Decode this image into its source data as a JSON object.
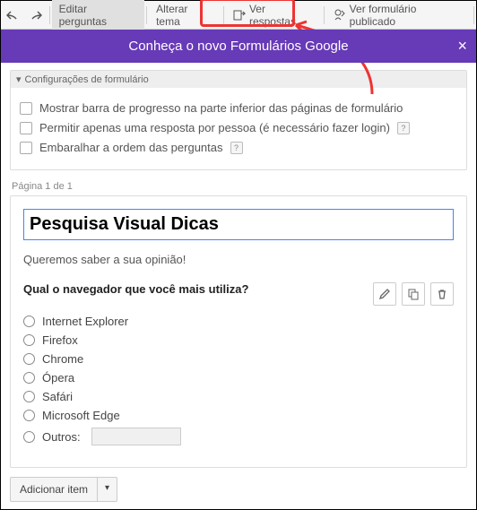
{
  "toolbar": {
    "edit_questions": "Editar perguntas",
    "change_theme": "Alterar tema",
    "view_responses": "Ver respostas",
    "view_published": "Ver formulário publicado"
  },
  "banner": {
    "text": "Conheça o novo Formulários Google"
  },
  "settings": {
    "header": "Configurações de formulário",
    "progress_bar": "Mostrar barra de progresso na parte inferior das páginas de formulário",
    "one_response": "Permitir apenas uma resposta por pessoa (é necessário fazer login)",
    "shuffle": "Embaralhar a ordem das perguntas"
  },
  "page_label": "Página 1 de 1",
  "form": {
    "title": "Pesquisa Visual Dicas",
    "description": "Queremos saber a sua opinião!",
    "question": "Qual o navegador que você mais utiliza?",
    "options": [
      "Internet Explorer",
      "Firefox",
      "Chrome",
      "Ópera",
      "Safári",
      "Microsoft Edge"
    ],
    "other_label": "Outros:"
  },
  "add_item": "Adicionar item"
}
